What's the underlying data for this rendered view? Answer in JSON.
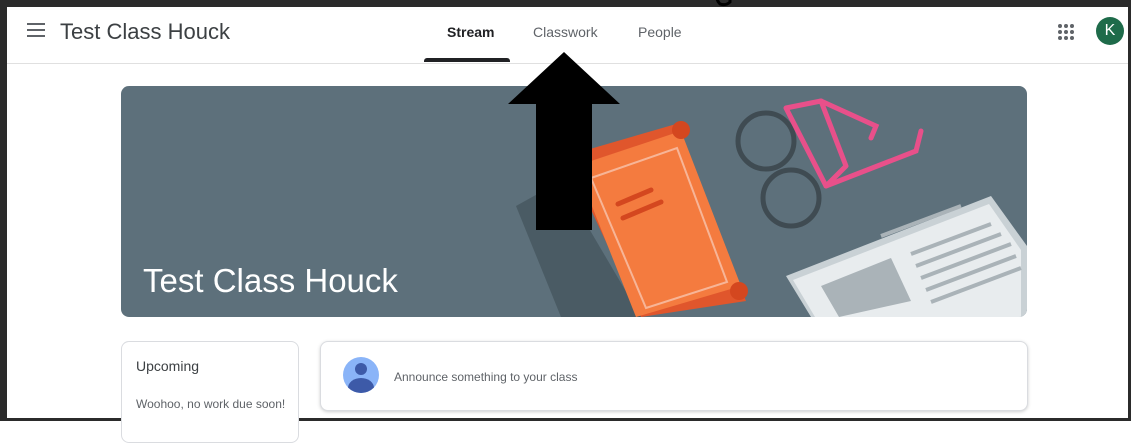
{
  "header": {
    "class_name": "Test Class Houck",
    "tabs": [
      {
        "label": "Stream",
        "active": true
      },
      {
        "label": "Classwork",
        "active": false
      },
      {
        "label": "People",
        "active": false
      }
    ],
    "avatar_initial": "K",
    "avatar_color": "#1e6b4a"
  },
  "banner": {
    "title": "Test Class Houck",
    "background_color": "#5d707b"
  },
  "upcoming": {
    "title": "Upcoming",
    "message": "Woohoo, no work due soon!"
  },
  "stream": {
    "announce_placeholder": "Announce something to your class"
  },
  "icons": [
    "menu-icon",
    "apps-grid-icon",
    "user-avatar-icon",
    "up-arrow-annotation"
  ],
  "colors": {
    "text_primary": "#202124",
    "text_secondary": "#5f6368",
    "banner_accent": "#f47b3f",
    "glasses": "#e8508a"
  }
}
